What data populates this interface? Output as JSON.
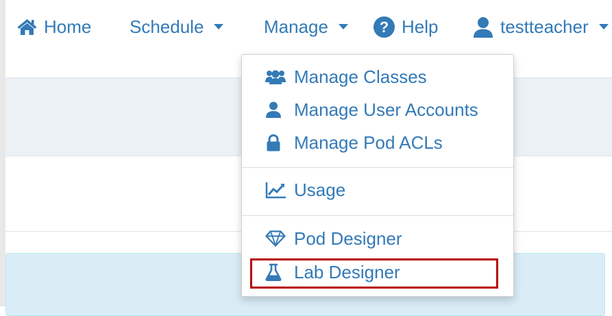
{
  "navbar": {
    "home_label": "Home",
    "schedule_label": "Schedule",
    "manage_label": "Manage",
    "help_label": "Help",
    "user_label": "testteacher"
  },
  "manage_menu": {
    "items": [
      {
        "label": "Manage Classes",
        "icon": "users-icon"
      },
      {
        "label": "Manage User Accounts",
        "icon": "user-icon"
      },
      {
        "label": "Manage Pod ACLs",
        "icon": "lock-icon"
      },
      {
        "label": "Usage",
        "icon": "line-chart-icon"
      },
      {
        "label": "Pod Designer",
        "icon": "diamond-icon"
      },
      {
        "label": "Lab Designer",
        "icon": "flask-icon"
      }
    ],
    "highlighted_item": "Lab Designer",
    "highlight_color": "#b50000"
  },
  "colors": {
    "link": "#337ab7",
    "panel_bg": "#ecf1f6",
    "alert_bg": "#d9edf7"
  }
}
